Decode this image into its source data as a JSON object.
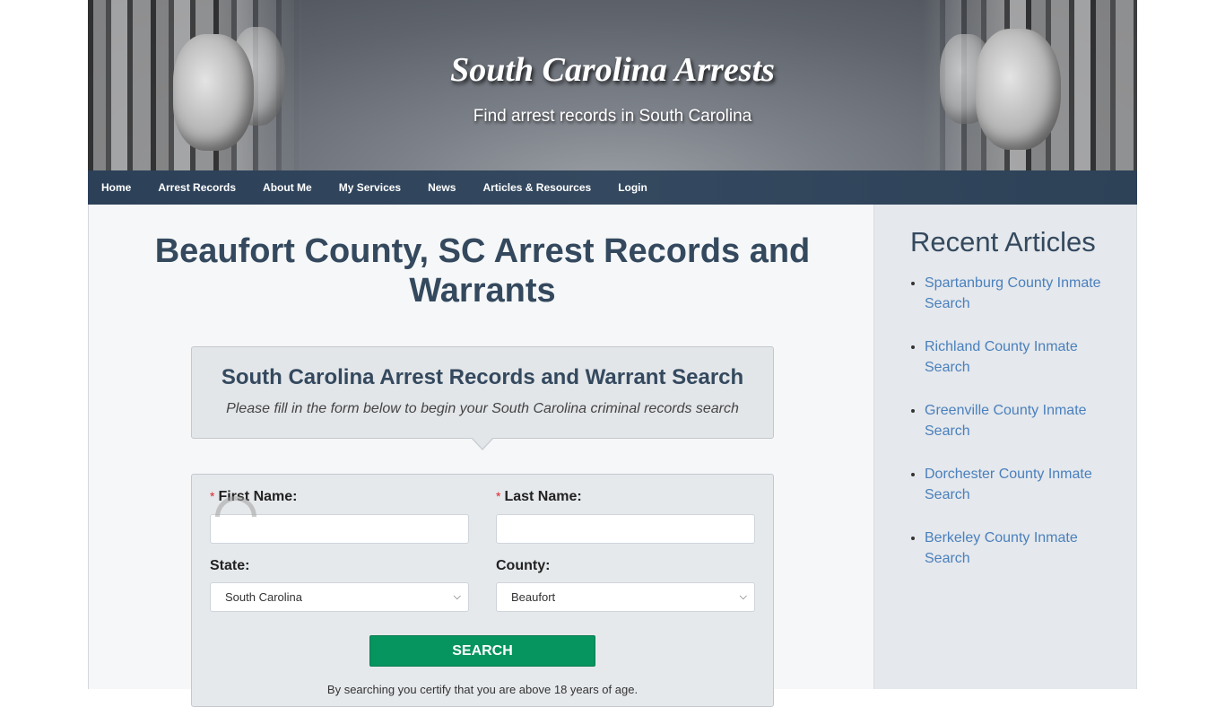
{
  "header": {
    "site_title": "South Carolina Arrests",
    "tagline": "Find arrest records in South Carolina"
  },
  "nav": {
    "items": [
      {
        "label": "Home"
      },
      {
        "label": "Arrest Records"
      },
      {
        "label": "About Me"
      },
      {
        "label": "My Services"
      },
      {
        "label": "News"
      },
      {
        "label": "Articles & Resources"
      },
      {
        "label": "Login"
      }
    ]
  },
  "main": {
    "page_title": "Beaufort County, SC Arrest Records and Warrants",
    "search_header": {
      "title": "South Carolina Arrest Records and Warrant Search",
      "subtitle": "Please fill in the form below to begin your South Carolina criminal records search"
    },
    "form": {
      "required_marker": "*",
      "first_name_label": "First Name:",
      "first_name_value": "",
      "last_name_label": "Last Name:",
      "last_name_value": "",
      "state_label": "State:",
      "state_selected": "South Carolina",
      "county_label": "County:",
      "county_selected": "Beaufort",
      "search_button": "SEARCH",
      "disclaimer": "By searching you certify that you are above 18 years of age."
    }
  },
  "sidebar": {
    "title": "Recent Articles",
    "articles": [
      {
        "label": "Spartanburg County Inmate Search"
      },
      {
        "label": "Richland County Inmate Search"
      },
      {
        "label": "Greenville County Inmate Search"
      },
      {
        "label": "Dorchester County Inmate Search"
      },
      {
        "label": "Berkeley County Inmate Search"
      }
    ]
  },
  "colors": {
    "nav_bg": "#2f4560",
    "heading": "#34495e",
    "link": "#4a80bd",
    "search_button": "#06945f",
    "required": "#d9242b"
  }
}
